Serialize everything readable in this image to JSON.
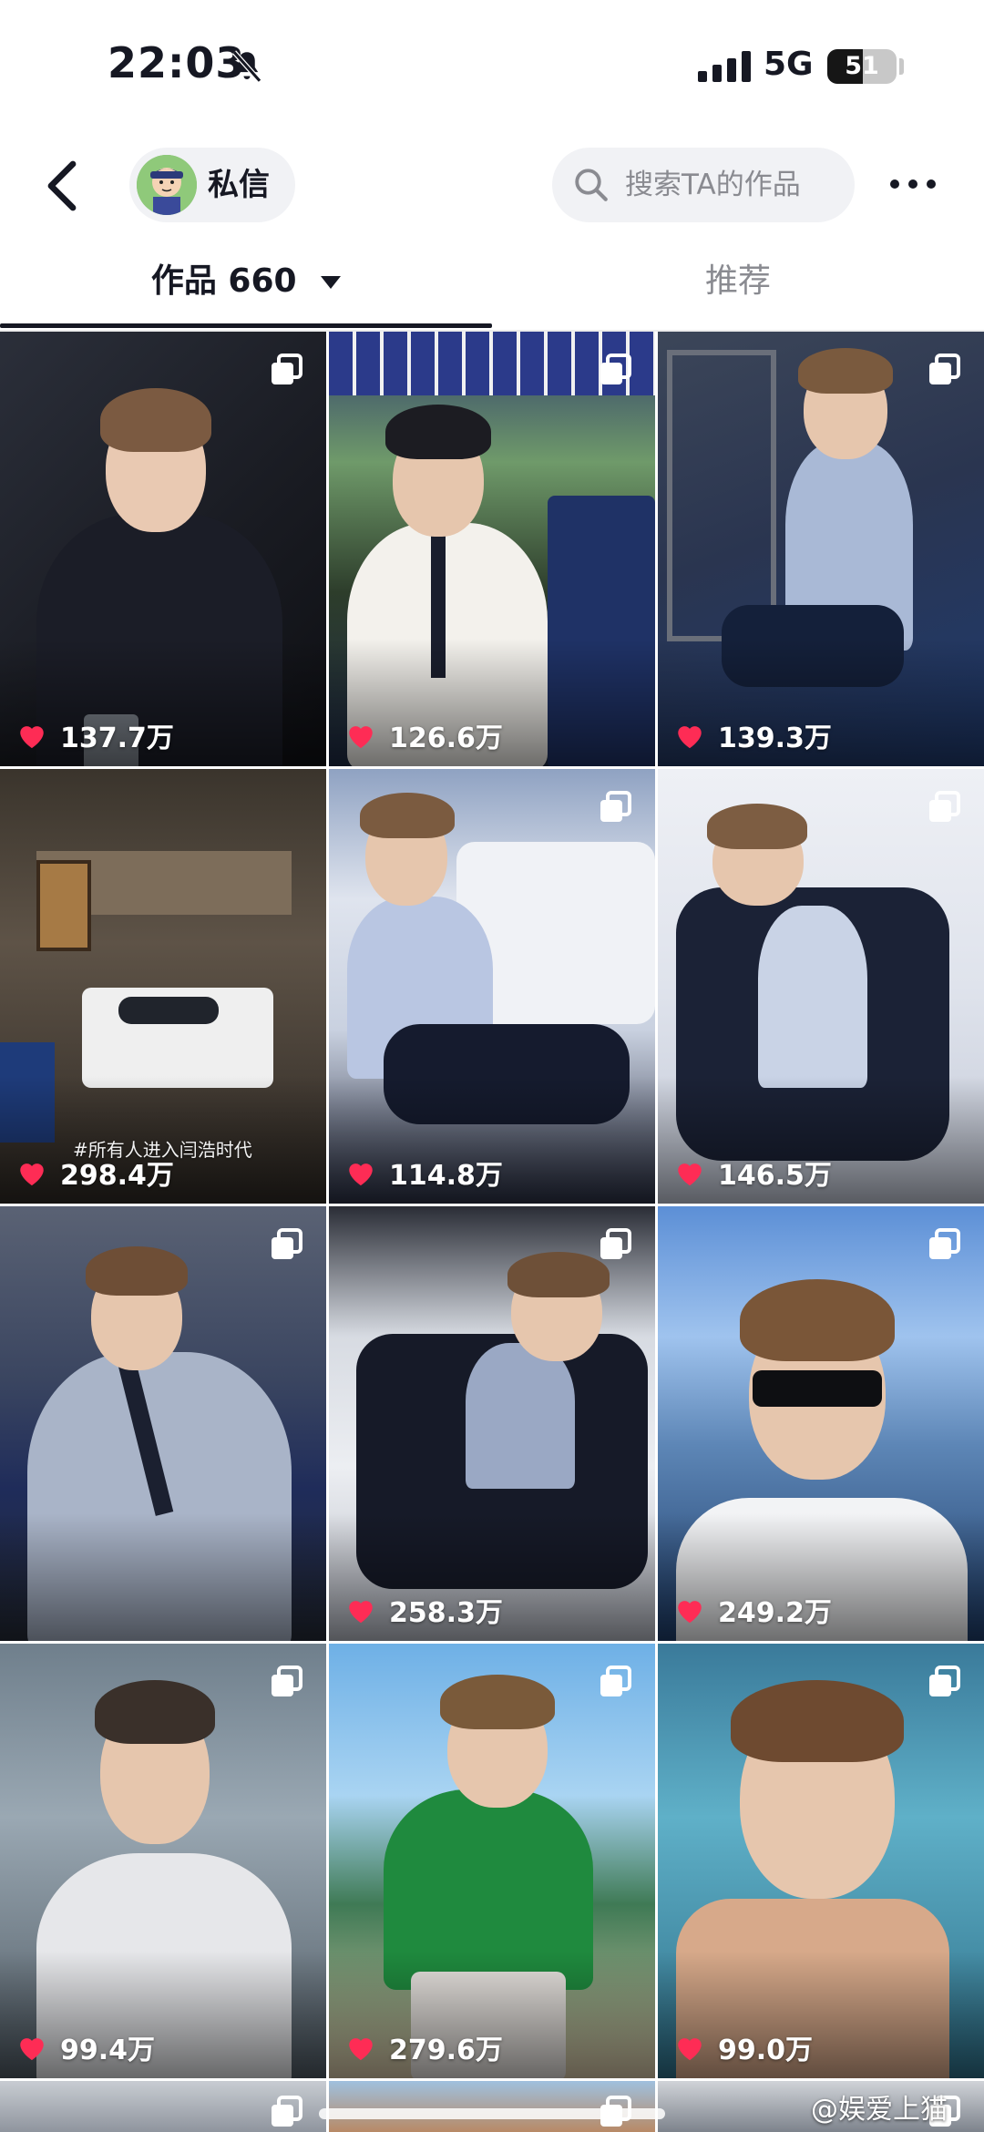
{
  "status_bar": {
    "time": "22:03",
    "network": "5G",
    "battery": "51",
    "battery_level": 0.51,
    "icons": [
      "bell-off-icon",
      "signal-icon"
    ]
  },
  "top_nav": {
    "back_icon": "chevron-left-icon",
    "dm_label": "私信",
    "search_placeholder": "搜索TA的作品",
    "more_icon": "more-icon"
  },
  "tabs": {
    "works_label": "作品",
    "works_count": "660",
    "recommend_label": "推荐"
  },
  "grid": {
    "tiles": [
      {
        "likes": "137.7万",
        "caption": ""
      },
      {
        "likes": "126.6万",
        "caption": ""
      },
      {
        "likes": "139.3万",
        "caption": ""
      },
      {
        "likes": "298.4万",
        "caption": "#所有人进入闫浩时代"
      },
      {
        "likes": "114.8万",
        "caption": ""
      },
      {
        "likes": "146.5万",
        "caption": ""
      },
      {
        "likes": "",
        "caption": ""
      },
      {
        "likes": "258.3万",
        "caption": ""
      },
      {
        "likes": "249.2万",
        "caption": ""
      },
      {
        "likes": "99.4万",
        "caption": ""
      },
      {
        "likes": "279.6万",
        "caption": ""
      },
      {
        "likes": "99.0万",
        "caption": ""
      },
      {
        "likes": "",
        "caption": ""
      },
      {
        "likes": "",
        "caption": ""
      },
      {
        "likes": "",
        "caption": ""
      }
    ]
  },
  "watermark": "@娱爱上猫",
  "colors": {
    "heart": "#fe2c55",
    "tab_active": "#161823",
    "tab_inactive": "#8a8b91",
    "chip_bg": "#f1f2f5"
  }
}
